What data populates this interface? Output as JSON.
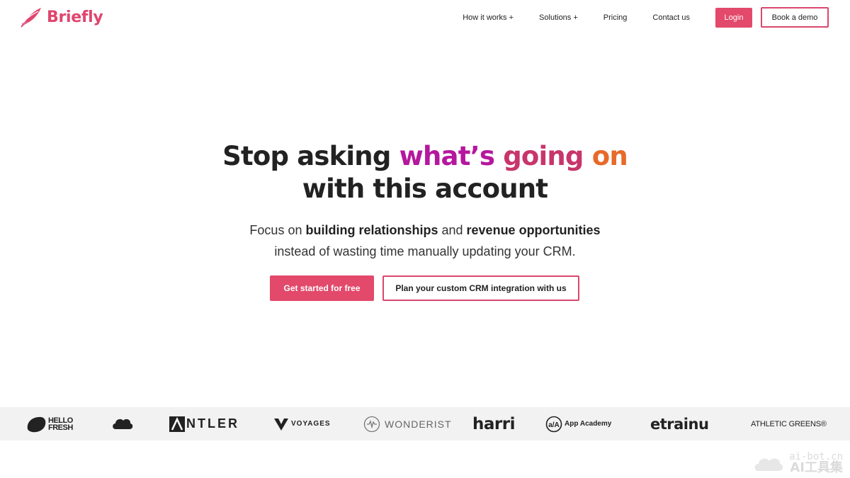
{
  "brand": {
    "name": "Briefly",
    "color": "#e0456e",
    "icon": "feather-icon"
  },
  "nav": {
    "links": [
      {
        "label": "How it works +"
      },
      {
        "label": "Solutions +"
      },
      {
        "label": "Pricing"
      },
      {
        "label": "Contact us"
      }
    ],
    "login_label": "Login",
    "demo_label": "Book a demo"
  },
  "hero": {
    "title_part1": "Stop asking ",
    "title_hl1": "what’s",
    "title_hl2": "going",
    "title_hl3": "on",
    "title_line2": "with this account",
    "sub_1": "Focus on ",
    "sub_bold1": "building relationships",
    "sub_2": " and ",
    "sub_bold2": "revenue opportunities",
    "sub_line2": "instead of wasting time manually updating your CRM.",
    "cta_primary": "Get started for free",
    "cta_secondary": "Plan your custom CRM integration with us"
  },
  "logos": [
    {
      "name": "HELLO FRESH",
      "line1": "HELLO",
      "line2": "FRESH"
    },
    {
      "name": "salesforce"
    },
    {
      "name": "ANTLER",
      "text": "NTLER"
    },
    {
      "name": "VOYAGES"
    },
    {
      "name": "WONDERIST"
    },
    {
      "name": "harri"
    },
    {
      "name": "App Academy"
    },
    {
      "name": "etrainu"
    },
    {
      "name": "ATHLETIC GREENS®"
    }
  ],
  "watermark": {
    "line1": "ai-bot.cn",
    "line2": "AI工具集"
  },
  "colors": {
    "accent": "#e2496b",
    "gradient_start": "#b5179e",
    "gradient_end": "#e76a2a"
  }
}
